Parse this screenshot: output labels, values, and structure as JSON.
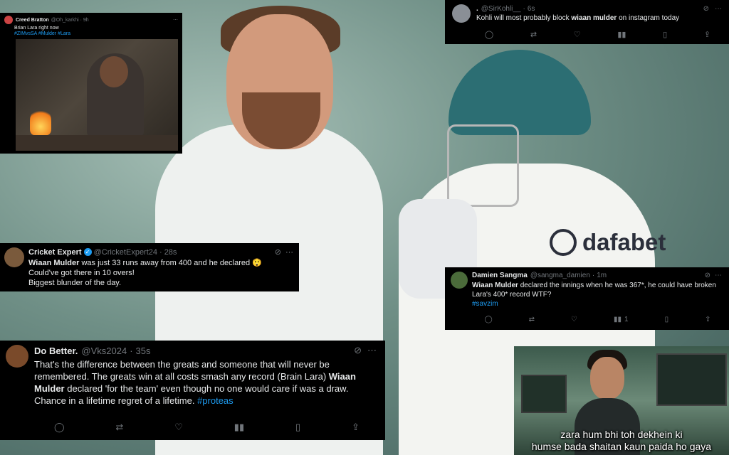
{
  "tweet_creed": {
    "name": "Creed Bratton",
    "handle": "@Oh_karkhi · 9h",
    "text": "Brian Lara right now",
    "hashtags": "#ZIMvsSA #Mulder #Lara"
  },
  "tweet_sirkohli": {
    "name": ".",
    "handle": "@SirKohli__",
    "time": "6s",
    "text_pre": "Kohli will most probably block ",
    "text_bold": "wiaan mulder",
    "text_post": " on instagram today"
  },
  "tweet_cricketexpert": {
    "name": "Cricket Expert",
    "handle": "@CricketExpert24",
    "time": "28s",
    "line1_bold": "Wiaan Mulder",
    "line1_rest": " was just 33 runs away from 400 and he declared 😲",
    "line2": "Could've got there in 10 overs!",
    "line3": "Biggest blunder of the day."
  },
  "tweet_damien": {
    "name": "Damien Sangma",
    "handle": "@sangma_damien",
    "time": "1m",
    "text_bold": "Wiaan Mulder",
    "text_rest": " declared the innings when he was 367*, he could have broken Lara's 400* record WTF?",
    "hashtag": "#savzim",
    "views": "1"
  },
  "tweet_dobetter": {
    "name": "Do Better.",
    "handle": "@Vks2024",
    "time": "35s",
    "text1": "That's the difference between the greats and someone that will never be remembered. The greats win at all costs smash any record (Brain Lara)",
    "text_bold": "Wiaan Mulder",
    "text2": "  declared 'for the team' even though no one would care if was a draw. Chance in a lifetime regret of a lifetime. ",
    "hashtag": "#proteas"
  },
  "meme": {
    "line1": "zara hum bhi toh dekhein ki",
    "line2": "humse bada shaitan kaun paida ho gaya"
  },
  "background": {
    "sponsor": "dafabet"
  },
  "colors": {
    "x_black": "#000000",
    "link_blue": "#1d9bf0",
    "muted_gray": "#71767b",
    "verified_blue": "#1d9bf0"
  }
}
